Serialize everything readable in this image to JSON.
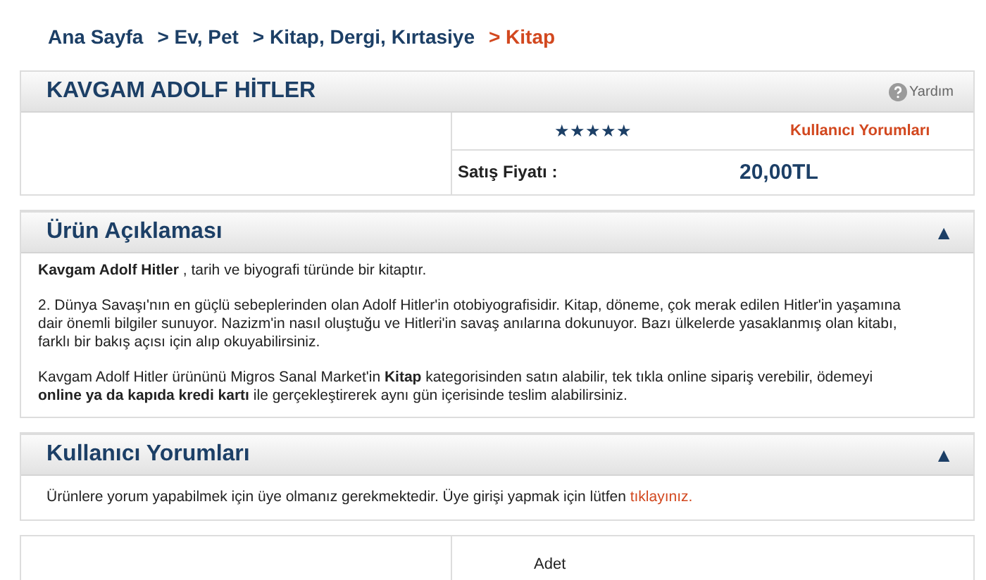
{
  "breadcrumb": [
    {
      "label": "Ana Sayfa",
      "current": false
    },
    {
      "label": "> Ev, Pet",
      "current": false
    },
    {
      "label": "> Kitap, Dergi, Kırtasiye",
      "current": false
    },
    {
      "label": "> Kitap",
      "current": true
    }
  ],
  "product": {
    "title": "KAVGAM ADOLF HİTLER",
    "help": "Yardım",
    "stars": 5,
    "reviews_link": "Kullanıcı Yorumları",
    "price_label": "Satış Fiyatı :",
    "price": "20,00TL"
  },
  "description": {
    "title": "Ürün Açıklaması",
    "toggle": "▲",
    "paragraphs": [
      "**Kavgam Adolf Hitler** , tarih ve biyografi türünde bir kitaptır.",
      "2. Dünya Savaşı'nın en güçlü sebeplerinden olan Adolf Hitler'in otobiyografisidir. Kitap, döneme, çok merak edilen Hitler'in yaşamına dair önemli bilgiler sunuyor. Nazizm'in nasıl oluştuğu ve Hitleri'in savaş anılarına dokunuyor. Bazı ülkelerde yasaklanmış olan kitabı, farklı bir bakış açısı için alıp okuyabilirsiniz.",
      "Kavgam Adolf Hitler ürününü Migros Sanal Market'in  **Kitap**  kategorisinden satın alabilir, tek tıkla online sipariş verebilir, ödemeyi  **online ya da kapıda kredi kartı**  ile gerçekleştirerek aynı gün içerisinde teslim alabilirsiniz."
    ]
  },
  "comments": {
    "title": "Kullanıcı Yorumları",
    "toggle": "▲",
    "notice": "Ürünlere yorum yapabilmek için üye olmanız gerekmektedir. Üye girişi yapmak için lütfen",
    "login_link": "tıklayınız."
  },
  "bottom": {
    "quantity_label": "Adet"
  }
}
